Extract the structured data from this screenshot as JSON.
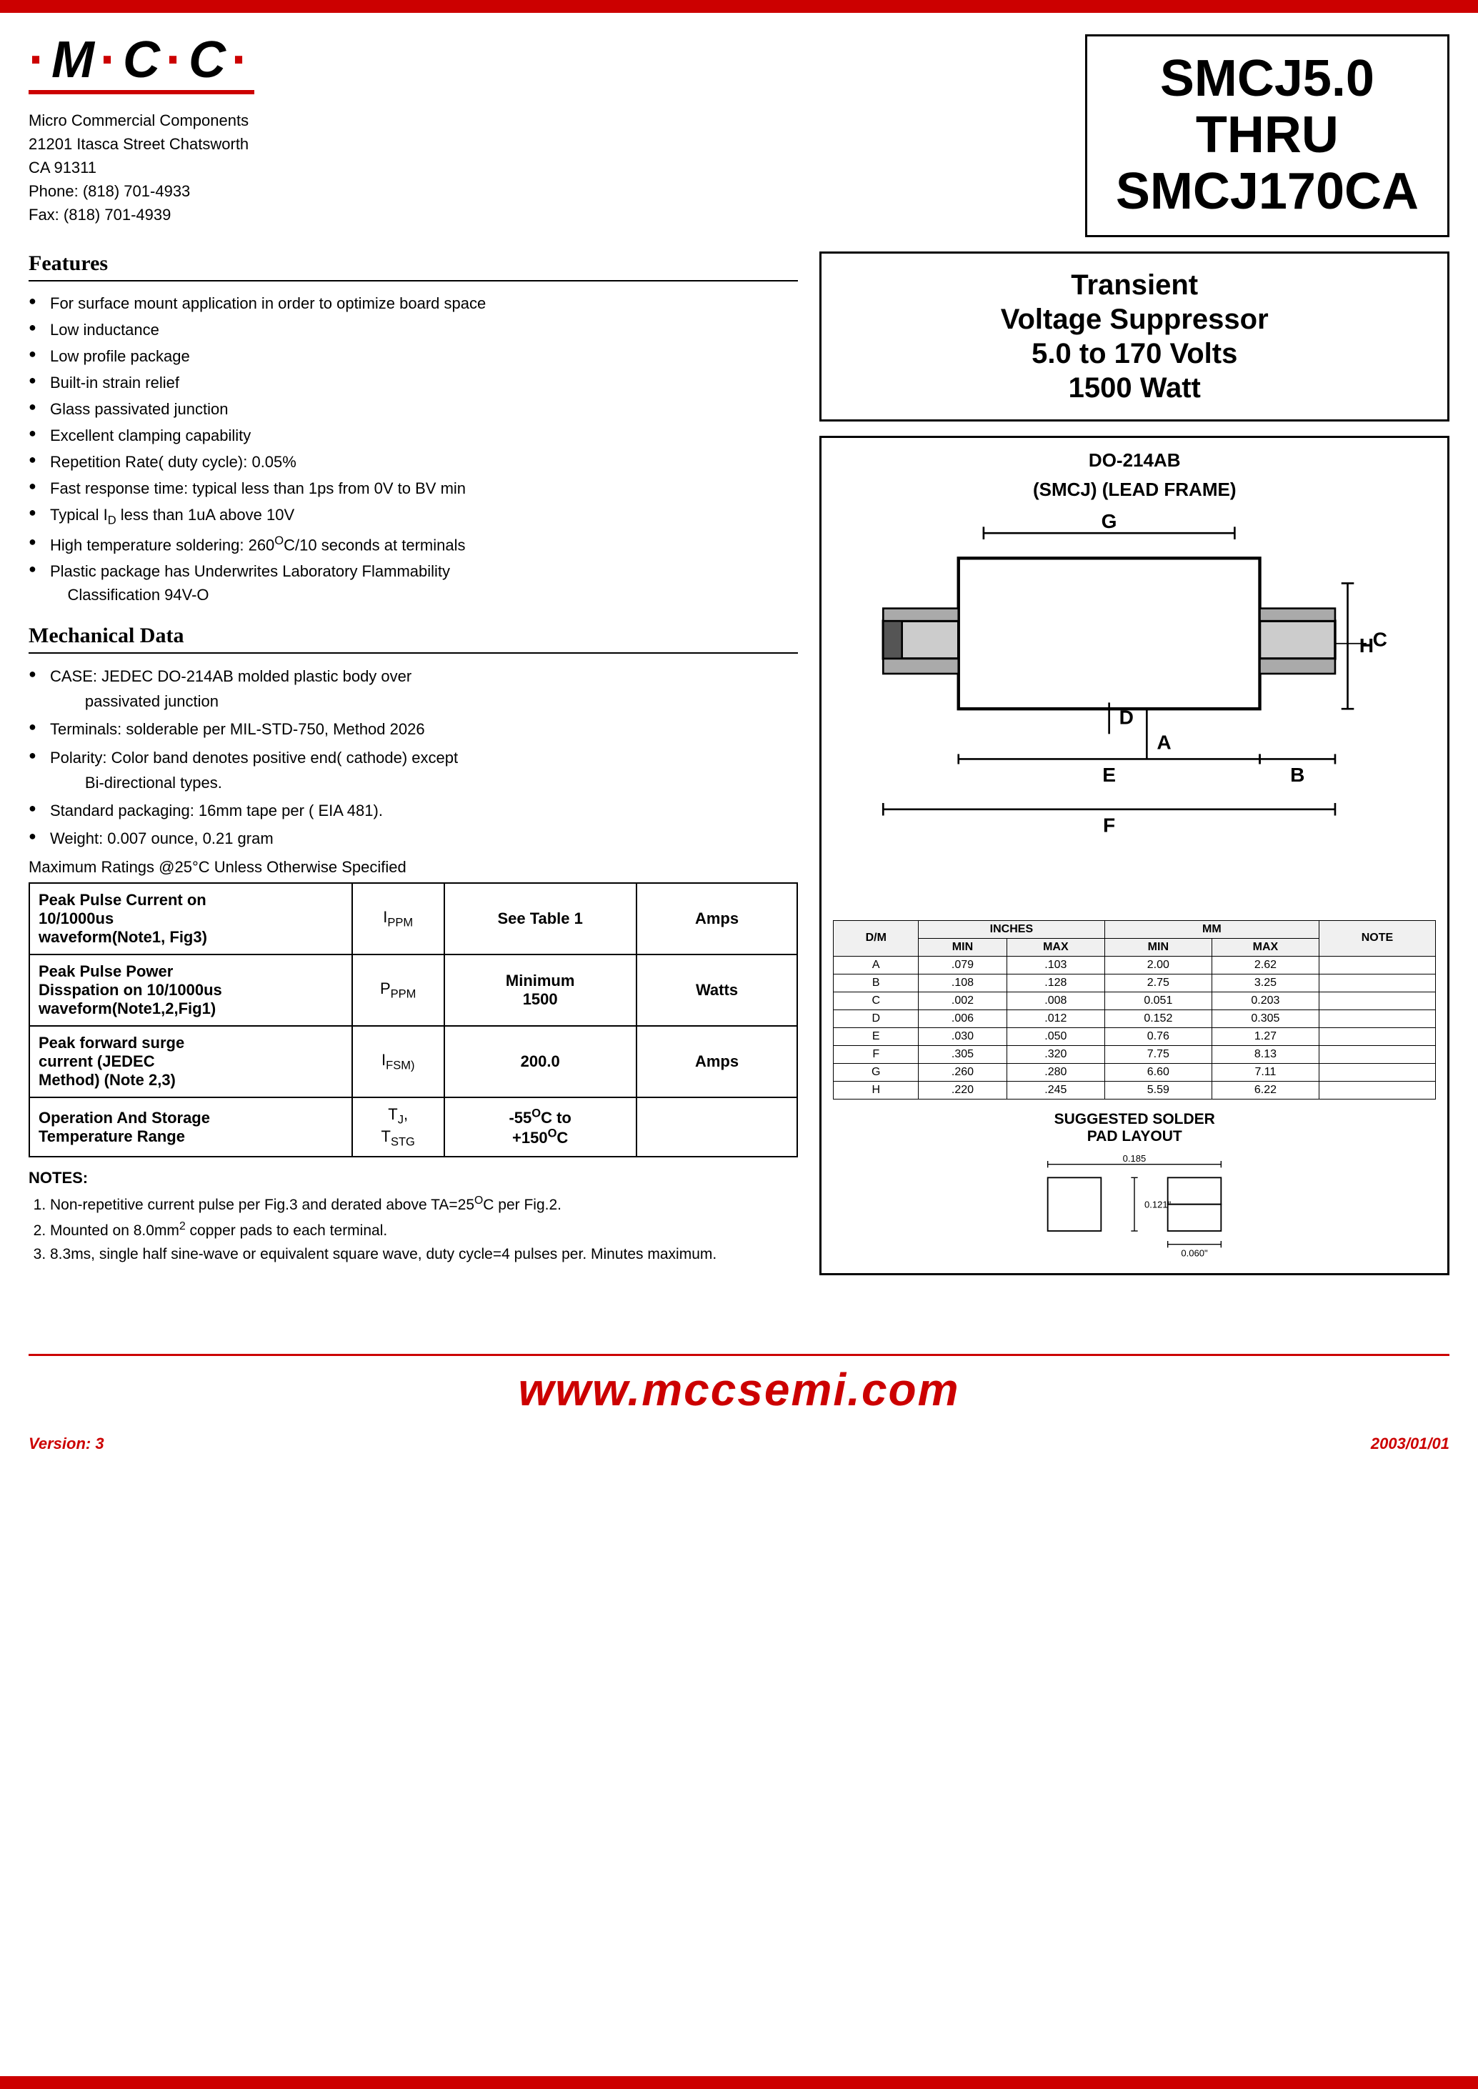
{
  "top_bar": "#cc0000",
  "logo": {
    "text": "·M·C·C·",
    "underline_color": "#cc0000"
  },
  "company": {
    "name": "Micro Commercial Components",
    "address1": "21201 Itasca Street Chatsworth",
    "address2": "CA 91311",
    "phone": "Phone: (818) 701-4933",
    "fax": "Fax:    (818) 701-4939"
  },
  "part_number": {
    "line1": "SMCJ5.0",
    "line2": "THRU",
    "line3": "SMCJ170CA"
  },
  "description": {
    "line1": "Transient",
    "line2": "Voltage Suppressor",
    "line3": "5.0 to 170 Volts",
    "line4": "1500 Watt"
  },
  "package": {
    "title1": "DO-214AB",
    "title2": "(SMCJ) (LEAD FRAME)"
  },
  "features_header": "Features",
  "features": [
    "For surface mount application in order to optimize board space",
    "Low inductance",
    "Low profile package",
    "Built-in strain relief",
    "Glass passivated junction",
    "Excellent clamping capability",
    "Repetition Rate( duty cycle): 0.05%",
    "Fast response time: typical less than 1ps from 0V to BV min",
    "Typical I₀ less than 1uA above 10V",
    "High temperature soldering: 260°C/10 seconds at terminals",
    "Plastic package has Underwrites Laboratory Flammability Classification 94V-O"
  ],
  "mech_header": "Mechanical Data",
  "mech_data": [
    "CASE: JEDEC DO-214AB molded plastic body over passivated junction",
    "Terminals:  solderable per MIL-STD-750, Method 2026",
    "Polarity: Color band denotes positive end( cathode) except Bi-directional types.",
    "Standard packaging: 16mm tape per ( EIA 481).",
    "Weight: 0.007 ounce, 0.21 gram"
  ],
  "max_ratings_note": "Maximum Ratings @25°C Unless Otherwise Specified",
  "ratings_table": [
    {
      "label": "Peak Pulse Current on 10/1000us waveform(Note1, Fig3)",
      "symbol": "IPPM",
      "value": "See Table 1",
      "unit": "Amps"
    },
    {
      "label": "Peak Pulse Power Disspation on 10/1000us waveform(Note1,2,Fig1)",
      "symbol": "PPPM",
      "value": "Minimum 1500",
      "unit": "Watts"
    },
    {
      "label": "Peak forward surge current (JEDEC Method) (Note 2,3)",
      "symbol": "IFSM",
      "value": "200.0",
      "unit": "Amps"
    },
    {
      "label": "Operation And Storage Temperature Range",
      "symbol": "TJ, TSTG",
      "value": "-55°C to +150°C",
      "unit": ""
    }
  ],
  "notes_header": "NOTES:",
  "notes": [
    "Non-repetitive current pulse per Fig.3 and derated above TA=25°C per Fig.2.",
    "Mounted on 8.0mm² copper pads to each terminal.",
    "8.3ms, single half sine-wave or equivalent square wave, duty cycle=4 pulses per. Minutes maximum."
  ],
  "dimensions_table": {
    "headers": [
      "D/M",
      "INCHES MIN",
      "INCHES MAX",
      "MM MIN",
      "MM MAX",
      "NOTE"
    ],
    "rows": [
      [
        "A",
        ".079",
        ".103",
        "2.00",
        "2.62",
        ""
      ],
      [
        "B",
        ".108",
        ".128",
        "2.75",
        "3.25",
        ""
      ],
      [
        "C",
        ".002",
        ".008",
        "0.051",
        "0.203",
        ""
      ],
      [
        "D",
        ".006",
        ".012",
        "0.152",
        "0.305",
        ""
      ],
      [
        "E",
        ".030",
        ".050",
        "0.76",
        "1.27",
        ""
      ],
      [
        "F",
        ".305",
        ".320",
        "7.75",
        "8.13",
        ""
      ],
      [
        "G",
        ".260",
        ".280",
        "6.60",
        "7.11",
        ""
      ],
      [
        "H",
        ".220",
        ".245",
        "5.59",
        "6.22",
        ""
      ]
    ]
  },
  "solder_pad": {
    "title": "SUGGESTED SOLDER PAD LAYOUT",
    "dim1": "0.185",
    "dim2": "0.121\"",
    "dim3": "0.060\""
  },
  "footer": {
    "website": "www.mccsemi.com",
    "version_label": "Version:",
    "version": "3",
    "date": "2003/01/01"
  }
}
